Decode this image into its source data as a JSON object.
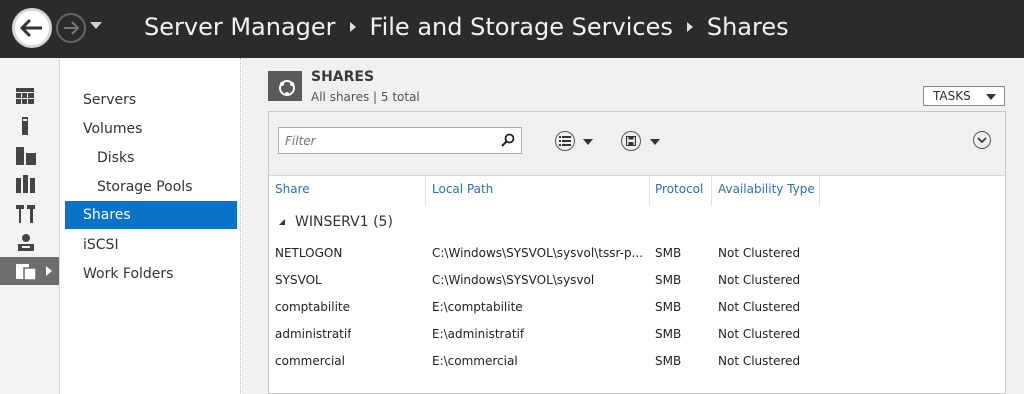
{
  "titlebar": {
    "breadcrumb": [
      "Server Manager",
      "File and Storage Services",
      "Shares"
    ]
  },
  "iconbar": {
    "items": [
      {
        "icon": "dashboard-icon"
      },
      {
        "icon": "local-server-icon"
      },
      {
        "icon": "all-servers-icon"
      },
      {
        "icon": "ad-ds-icon"
      },
      {
        "icon": "dns-tools-icon"
      },
      {
        "icon": "users-roles-icon"
      },
      {
        "icon": "file-storage-icon",
        "active": true
      }
    ]
  },
  "sidenav": {
    "items": [
      {
        "label": "Servers"
      },
      {
        "label": "Volumes"
      },
      {
        "label": "Disks",
        "sub": true
      },
      {
        "label": "Storage Pools",
        "sub": true
      },
      {
        "label": "Shares",
        "active": true
      },
      {
        "label": "iSCSI"
      },
      {
        "label": "Work Folders"
      }
    ]
  },
  "content": {
    "title": "SHARES",
    "subtitle": "All shares | 5 total",
    "tasks_label": "TASKS",
    "filter_placeholder": "Filter",
    "columns": [
      "Share",
      "Local Path",
      "Protocol",
      "Availability Type"
    ],
    "group_label": "WINSERV1 (5)",
    "rows": [
      {
        "share": "NETLOGON",
        "path": "C:\\Windows\\SYSVOL\\sysvol\\tssr-p...",
        "protocol": "SMB",
        "availability": "Not Clustered"
      },
      {
        "share": "SYSVOL",
        "path": "C:\\Windows\\SYSVOL\\sysvol",
        "protocol": "SMB",
        "availability": "Not Clustered"
      },
      {
        "share": "comptabilite",
        "path": "E:\\comptabilite",
        "protocol": "SMB",
        "availability": "Not Clustered"
      },
      {
        "share": "administratif",
        "path": "E:\\administratif",
        "protocol": "SMB",
        "availability": "Not Clustered"
      },
      {
        "share": "commercial",
        "path": "E:\\commercial",
        "protocol": "SMB",
        "availability": "Not Clustered"
      }
    ]
  },
  "colors": {
    "titlebar": "#2b2b2b",
    "accent": "#0a73c6",
    "column_header": "#2a72b5"
  }
}
